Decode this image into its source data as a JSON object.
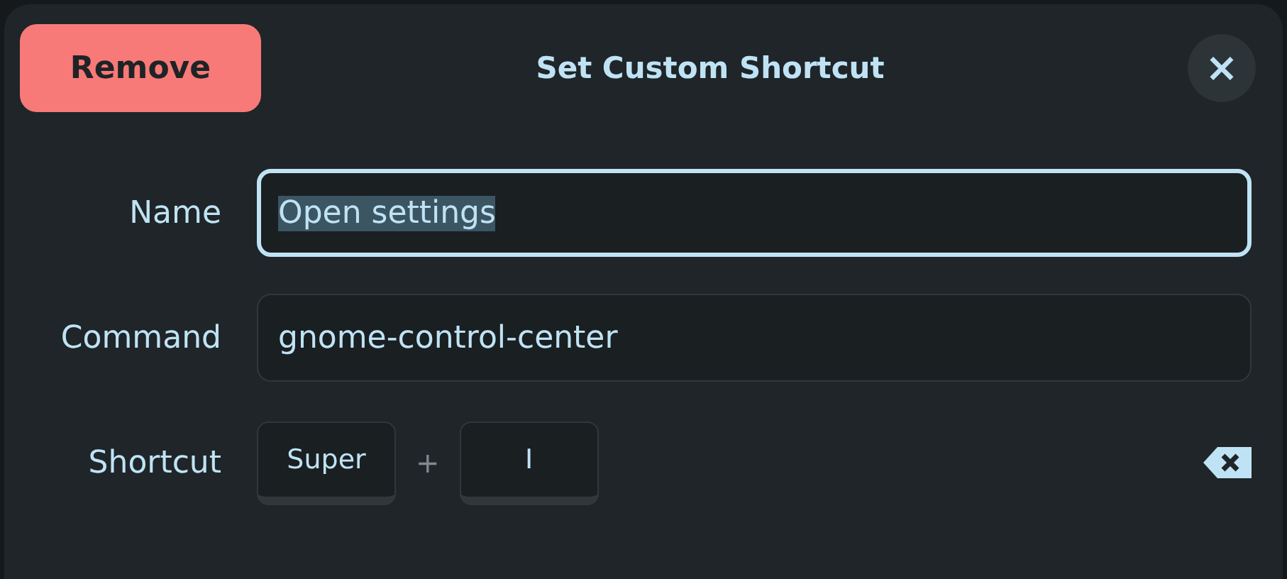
{
  "header": {
    "remove_button": "Remove",
    "title": "Set Custom Shortcut",
    "close_button": "×"
  },
  "fields": [
    {
      "label": "Name",
      "value": "Open settings",
      "focused": true,
      "text_selected": true
    },
    {
      "label": "Command",
      "value": "gnome-control-center",
      "focused": false,
      "text_selected": false
    }
  ],
  "shortcut": {
    "label": "Shortcut",
    "keys": [
      "Super",
      "I"
    ],
    "separator": "+"
  }
}
